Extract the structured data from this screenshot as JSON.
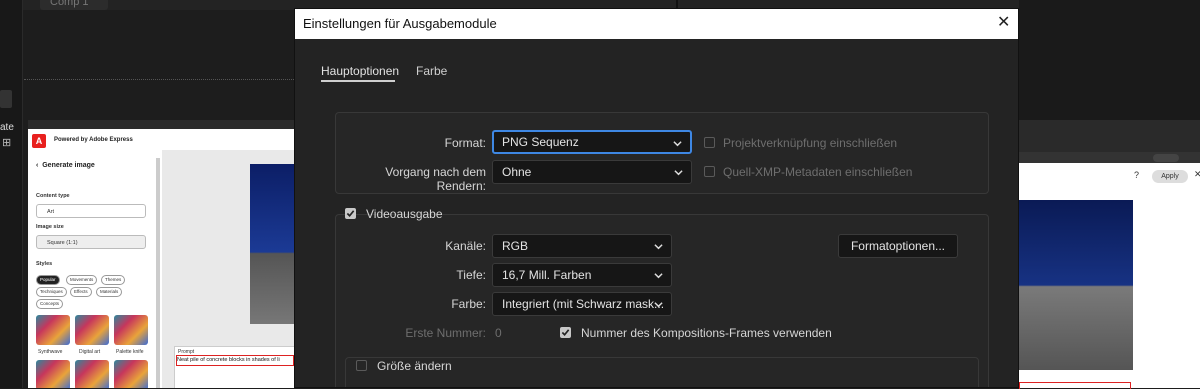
{
  "background": {
    "comp_tab": "Comp 1",
    "gutter_text": "ate",
    "adobe_express": {
      "powered_by": "Powered by Adobe Express",
      "generate_image": "Generate image",
      "content_type_label": "Content type",
      "content_type_value": "Art",
      "image_size_label": "Image size",
      "image_size_value": "Square (1:1)",
      "styles_label": "Styles",
      "style_chips": [
        "Popular",
        "Movements",
        "Themes",
        "Techniques",
        "Effects",
        "Materials",
        "Concepts"
      ],
      "thumbnails": [
        "Synthwave",
        "Digital art",
        "Palette knife"
      ],
      "prompt_label": "Prompt",
      "prompt_text": "Neat pile of concrete blocks in shades of li"
    },
    "right_apply": "Apply"
  },
  "dialog": {
    "title": "Einstellungen für Ausgabemodule",
    "tabs": [
      "Hauptoptionen",
      "Farbe"
    ],
    "format_label": "Format:",
    "format_value": "PNG Sequenz",
    "post_render_label": "Vorgang nach dem Rendern:",
    "post_render_value": "Ohne",
    "include_project_link": "Projektverknüpfung einschließen",
    "include_xmp": "Quell-XMP-Metadaten einschließen",
    "video_output": "Videoausgabe",
    "channels_label": "Kanäle:",
    "channels_value": "RGB",
    "depth_label": "Tiefe:",
    "depth_value": "16,7 Mill. Farben",
    "color_label": "Farbe:",
    "color_value": "Integriert (mit Schwarz mask...",
    "format_options_button": "Formatoptionen...",
    "first_number_label": "Erste Nummer:",
    "first_number_value": "0",
    "use_comp_frame": "Nummer des Kompositions-Frames verwenden",
    "resize": "Größe ändern"
  },
  "colors": {
    "focus": "#3e87e3",
    "dialog_bg": "#232323"
  }
}
